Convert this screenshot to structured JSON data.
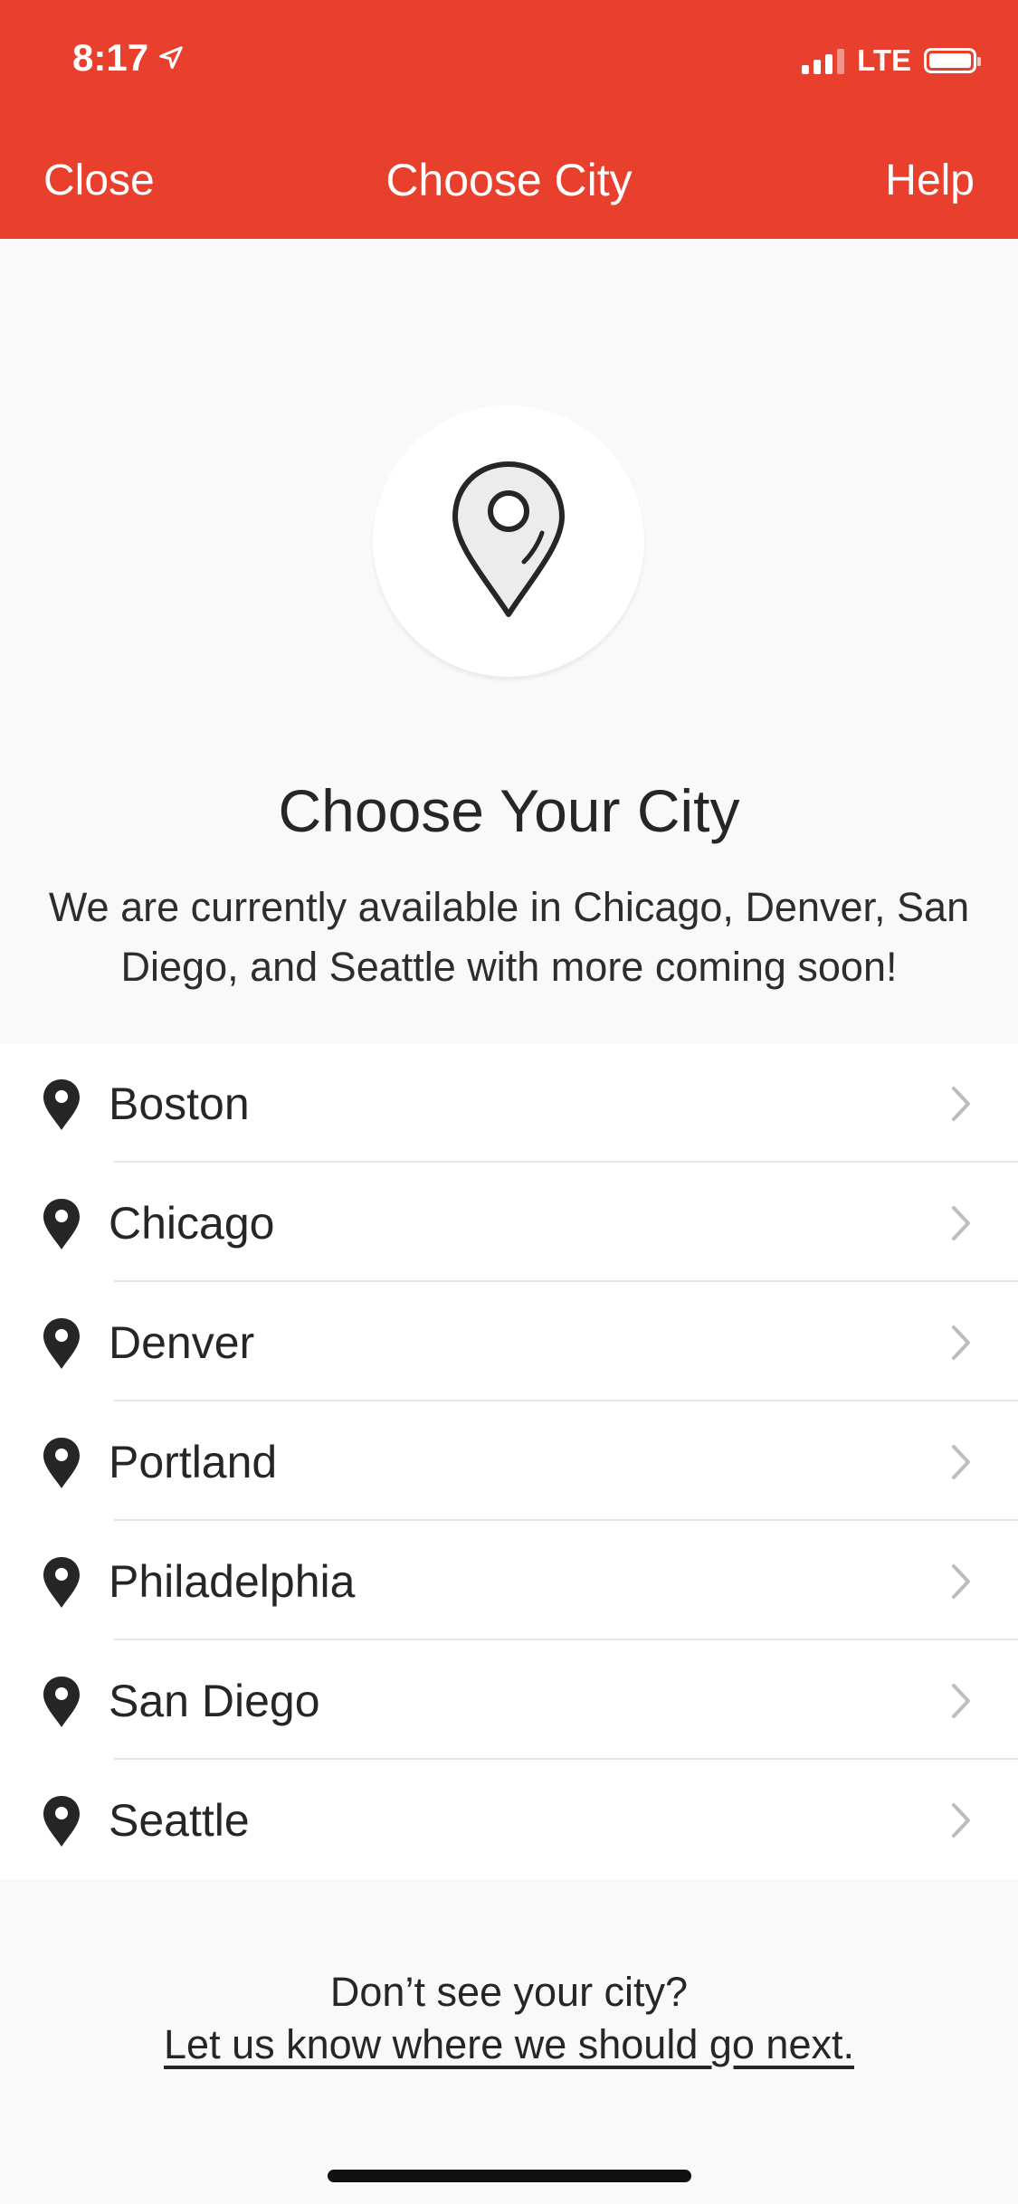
{
  "status_bar": {
    "time": "8:17",
    "network": "LTE"
  },
  "nav": {
    "close_label": "Close",
    "title": "Choose City",
    "help_label": "Help"
  },
  "hero": {
    "heading": "Choose Your City",
    "description": "We are currently available in Chicago, Denver, San Diego, and Seattle with more coming soon!"
  },
  "cities": [
    {
      "label": "Boston"
    },
    {
      "label": "Chicago"
    },
    {
      "label": "Denver"
    },
    {
      "label": "Portland"
    },
    {
      "label": "Philadelphia"
    },
    {
      "label": "San Diego"
    },
    {
      "label": "Seattle"
    }
  ],
  "footer": {
    "question": "Don’t see your city?",
    "link": "Let us know where we should go next."
  },
  "colors": {
    "accent": "#e8402c",
    "background": "#f9f9f9",
    "text": "#262626"
  }
}
